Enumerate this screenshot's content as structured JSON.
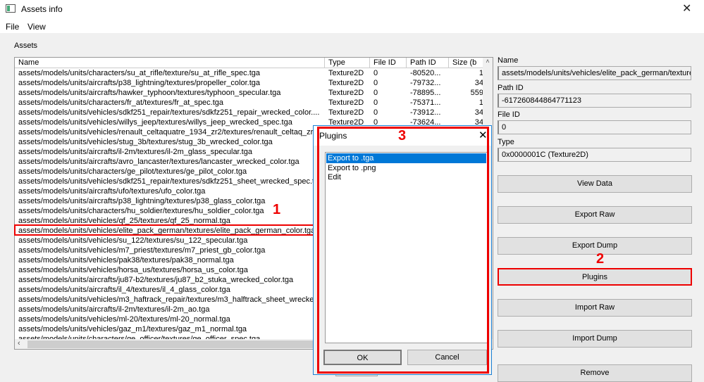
{
  "window": {
    "title": "Assets info",
    "close": "✕"
  },
  "menu": [
    "File",
    "View"
  ],
  "assets_label": "Assets",
  "columns": [
    "Name",
    "Type",
    "File ID",
    "Path ID",
    "Size (b"
  ],
  "rows": [
    {
      "name": "assets/models/units/characters/su_at_rifle/texture/su_at_rifle_spec.tga",
      "type": "Texture2D",
      "file_id": "0",
      "path_id": "-80520...",
      "size": "1"
    },
    {
      "name": "assets/models/units/aircrafts/p38_lightning/textures/propeller_color.tga",
      "type": "Texture2D",
      "file_id": "0",
      "path_id": "-79732...",
      "size": "34"
    },
    {
      "name": "assets/models/units/aircrafts/hawker_typhoon/textures/typhoon_specular.tga",
      "type": "Texture2D",
      "file_id": "0",
      "path_id": "-78895...",
      "size": "559"
    },
    {
      "name": "assets/models/units/characters/fr_at/textures/fr_at_spec.tga",
      "type": "Texture2D",
      "file_id": "0",
      "path_id": "-75371...",
      "size": "1"
    },
    {
      "name": "assets/models/units/vehicles/sdkf251_repair/textures/sdkfz251_repair_wrecked_color....",
      "type": "Texture2D",
      "file_id": "0",
      "path_id": "-73912...",
      "size": "34"
    },
    {
      "name": "assets/models/units/vehicles/willys_jeep/textures/willys_jeep_wrecked_spec.tga",
      "type": "Texture2D",
      "file_id": "0",
      "path_id": "-73624...",
      "size": "34"
    },
    {
      "name": "assets/models/units/vehicles/renault_celtaquatre_1934_zr2/textures/renault_celtaq_zr"
    },
    {
      "name": "assets/models/units/vehicles/stug_3b/textures/stug_3b_wrecked_color.tga"
    },
    {
      "name": "assets/models/units/aircrafts/il-2m/textures/il-2m_glass_specular.tga"
    },
    {
      "name": "assets/models/units/aircrafts/avro_lancaster/textures/lancaster_wrecked_color.tga"
    },
    {
      "name": "assets/models/units/characters/ge_pilot/textures/ge_pilot_color.tga"
    },
    {
      "name": "assets/models/units/vehicles/sdkf251_repair/textures/sdkfz251_sheet_wrecked_spec.t"
    },
    {
      "name": "assets/models/units/aircrafts/ufo/textures/ufo_color.tga"
    },
    {
      "name": "assets/models/units/aircrafts/p38_lightning/textures/p38_glass_color.tga"
    },
    {
      "name": "assets/models/units/characters/hu_soldier/textures/hu_soldier_color.tga"
    },
    {
      "name": "assets/models/units/vehicles/qf_25/textures/qf_25_normal.tga"
    },
    {
      "name": "assets/models/units/vehicles/elite_pack_german/textures/elite_pack_german_color.tga"
    },
    {
      "name": "assets/models/units/vehicles/su_122/textures/su_122_specular.tga"
    },
    {
      "name": "assets/models/units/vehicles/m7_priest/textures/m7_priest_gb_color.tga"
    },
    {
      "name": "assets/models/units/vehicles/pak38/textures/pak38_normal.tga"
    },
    {
      "name": "assets/models/units/vehicles/horsa_us/textures/horsa_us_color.tga"
    },
    {
      "name": "assets/models/units/aircrafts/ju87-b2/textures/ju87_b2_stuka_wrecked_color.tga"
    },
    {
      "name": "assets/models/units/aircrafts/il_4/textures/il_4_glass_color.tga"
    },
    {
      "name": "assets/models/units/vehicles/m3_haftrack_repair/textures/m3_halftrack_sheet_wrecke"
    },
    {
      "name": "assets/models/units/aircrafts/il-2m/textures/il-2m_ao.tga"
    },
    {
      "name": "assets/models/units/vehicles/ml-20/textures/ml-20_normal.tga"
    },
    {
      "name": "assets/models/units/vehicles/gaz_m1/textures/gaz_m1_normal.tga"
    },
    {
      "name": "assets/models/units/characters/ge_officer/textures/ge_officer_spec.tga"
    }
  ],
  "details": {
    "name_label": "Name",
    "name_value": "assets/models/units/vehicles/elite_pack_german/textures/elite_pack_german_color.tga",
    "path_id_label": "Path ID",
    "path_id_value": "-617260844864771123",
    "file_id_label": "File ID",
    "file_id_value": "0",
    "type_label": "Type",
    "type_value": "0x0000001C (Texture2D)"
  },
  "buttons": [
    "View Data",
    "Export Raw",
    "Export Dump",
    "Plugins",
    "Import Raw",
    "Import Dump",
    "Remove"
  ],
  "annotations": [
    "1",
    "2",
    "3"
  ],
  "dialog": {
    "title": "Plugins",
    "items": [
      "Export to .tga",
      "Export to .png",
      "Edit"
    ],
    "ok": "OK",
    "cancel": "Cancel"
  },
  "colors": {
    "highlight": "#0078d7",
    "annotation": "#ee0000"
  }
}
